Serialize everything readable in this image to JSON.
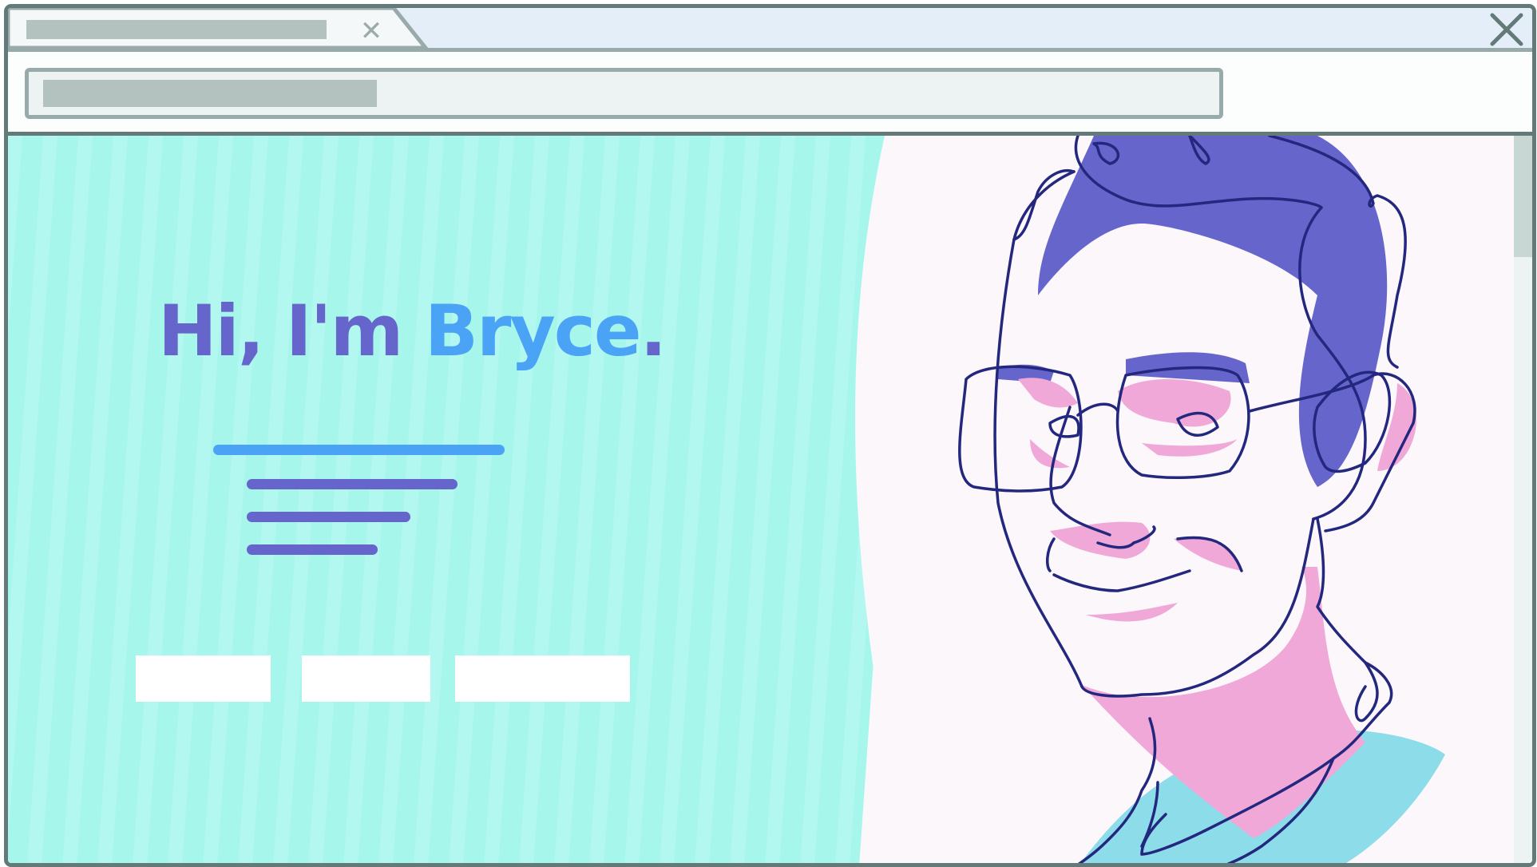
{
  "browser": {
    "tab_close_glyph": "✕",
    "icons": [
      "close-icon",
      "window-close-icon"
    ]
  },
  "page": {
    "headline": {
      "greeting": "Hi, I'm ",
      "name": "Bryce",
      "punctuation": "."
    }
  },
  "colors": {
    "primary": "#6565cc",
    "accent": "#4aa3f5",
    "teal_background": "#a6f6ec",
    "portrait_pink": "#f0a8d8",
    "shirt_blue": "#8ddcea"
  }
}
